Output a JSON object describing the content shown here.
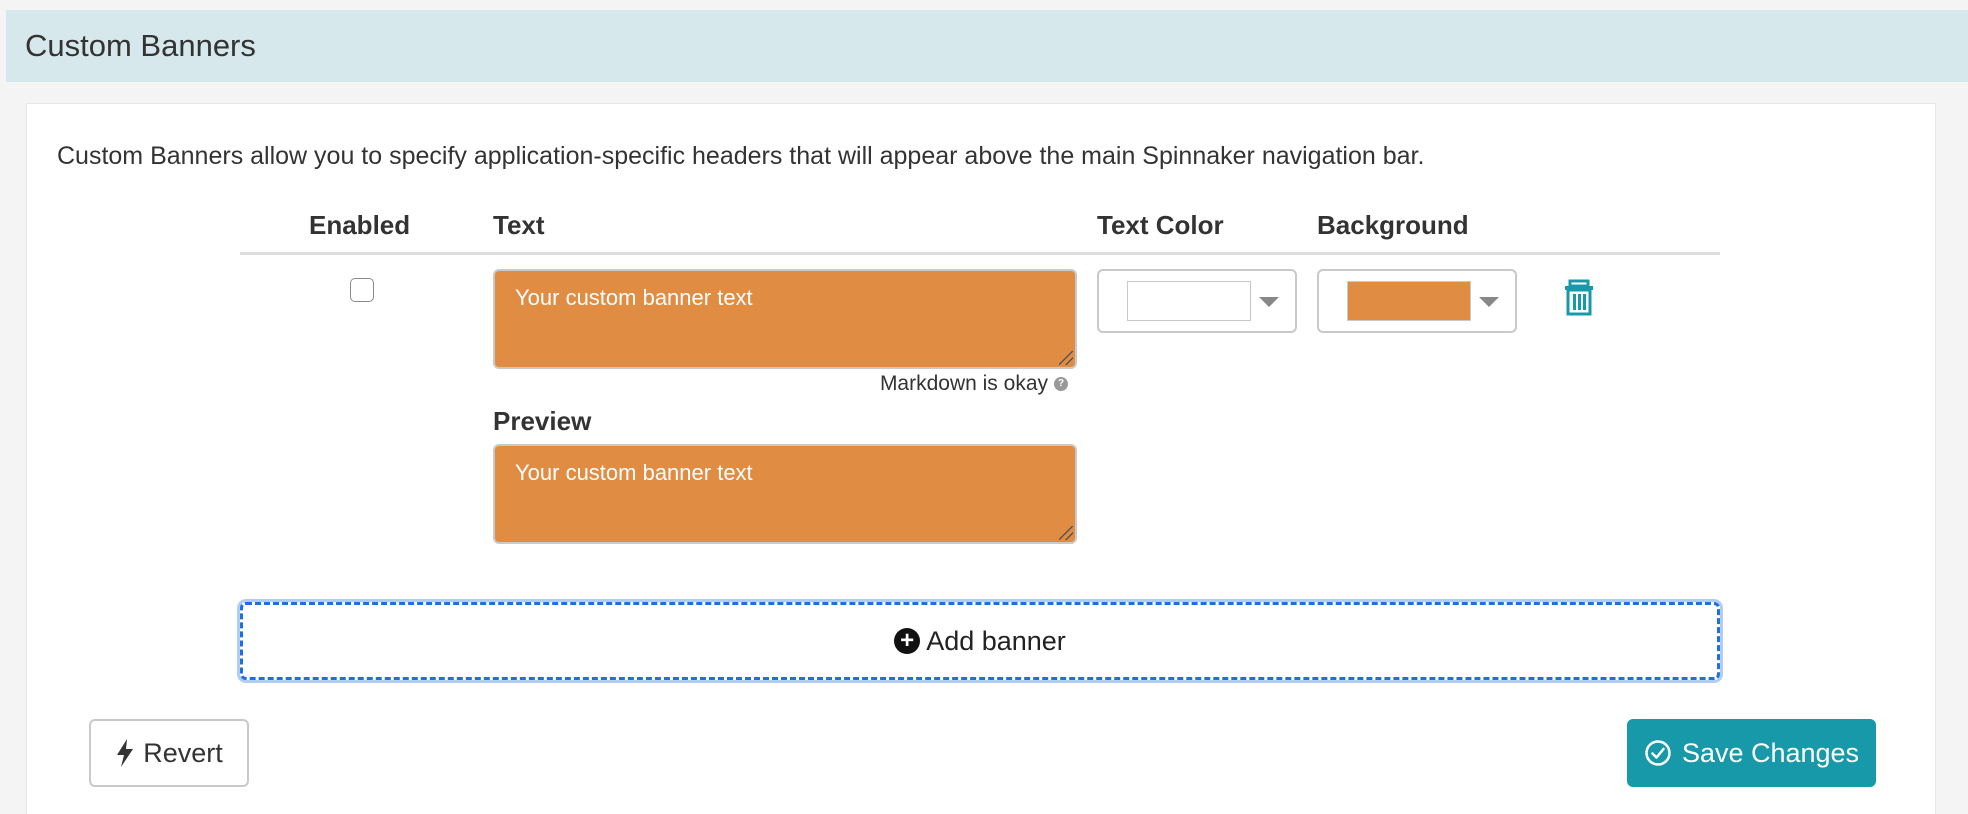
{
  "section": {
    "title": "Custom Banners"
  },
  "description": "Custom Banners allow you to specify application-specific headers that will appear above the main Spinnaker navigation bar.",
  "table": {
    "headers": {
      "enabled": "Enabled",
      "text": "Text",
      "text_color": "Text Color",
      "background": "Background"
    }
  },
  "banners": [
    {
      "enabled": false,
      "text": "Your custom banner text",
      "text_hint": "Markdown is okay",
      "preview_label": "Preview",
      "preview_text": "Your custom banner text",
      "text_color": "#ffffff",
      "background_color": "#e08c43"
    }
  ],
  "icons": {
    "help": "question-circle-icon",
    "delete": "trash-icon",
    "add": "plus-circle-icon",
    "revert": "lightning-bolt-icon",
    "save": "check-circle-icon"
  },
  "actions": {
    "add_banner_label": "Add banner",
    "revert_label": "Revert",
    "save_label": "Save Changes"
  },
  "colors": {
    "header_bg": "#d6e8ec",
    "primary": "#1899a9",
    "focus": "#1f6fe0",
    "delete_icon": "#1899a9"
  }
}
